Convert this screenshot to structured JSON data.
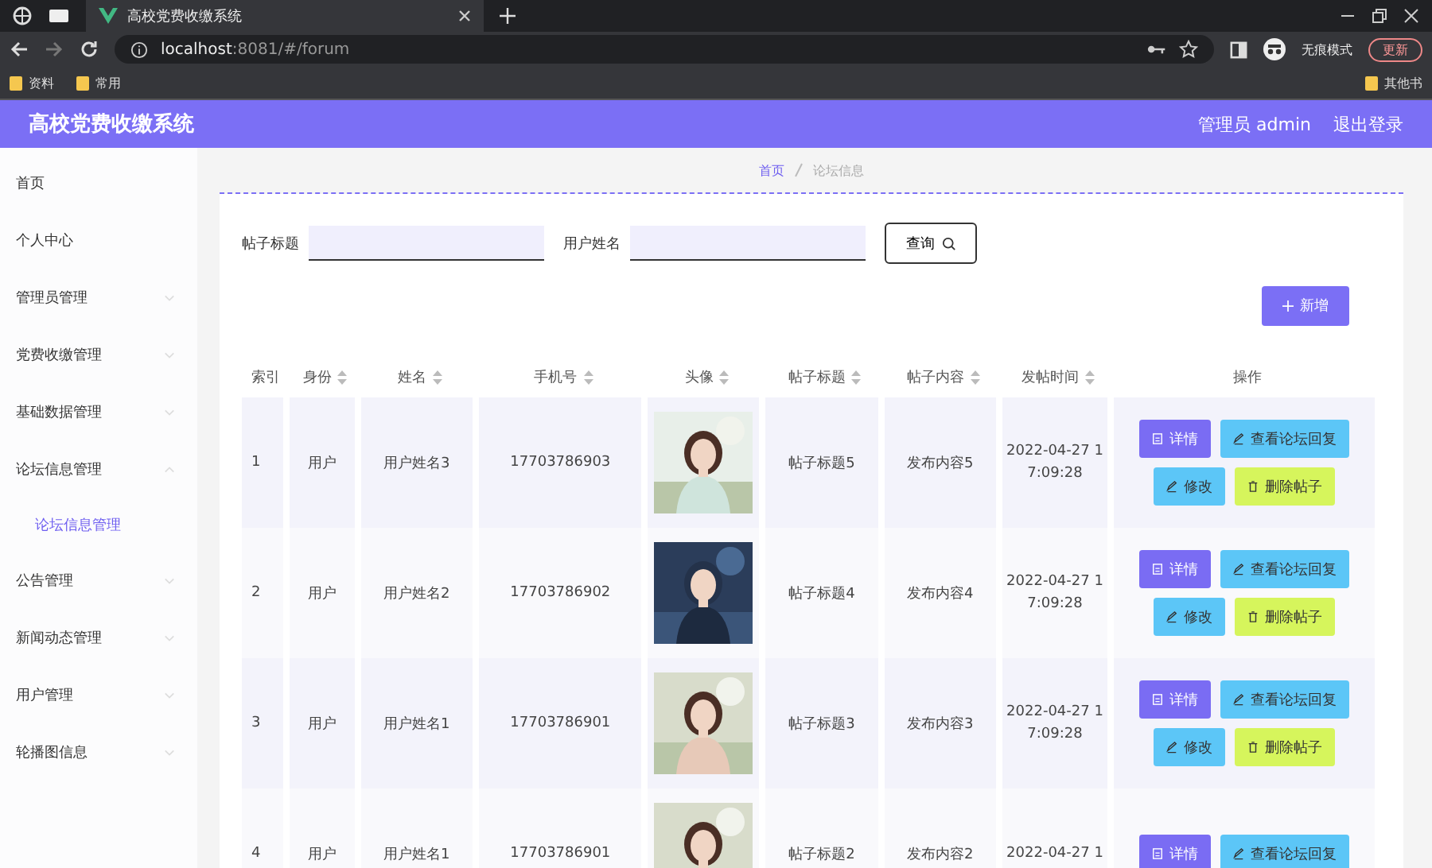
{
  "browser": {
    "tab_title": "高校党费收缴系统",
    "url_host": "localhost",
    "url_rest": ":8081/#/forum",
    "incognito": "无痕模式",
    "update": "更新",
    "bookmarks": [
      "资料",
      "常用"
    ],
    "other_bookmarks": "其他书"
  },
  "header": {
    "title": "高校党费收缴系统",
    "user": "管理员 admin",
    "logout": "退出登录"
  },
  "sidebar": {
    "items": [
      {
        "label": "首页",
        "has_children": false
      },
      {
        "label": "个人中心",
        "has_children": false
      },
      {
        "label": "管理员管理",
        "expanded": false,
        "has_children": true
      },
      {
        "label": "党费收缴管理",
        "expanded": false,
        "has_children": true
      },
      {
        "label": "基础数据管理",
        "expanded": false,
        "has_children": true
      },
      {
        "label": "论坛信息管理",
        "expanded": true,
        "has_children": true,
        "children": [
          {
            "label": "论坛信息管理",
            "selected": true
          }
        ]
      },
      {
        "label": "公告管理",
        "expanded": false,
        "has_children": true
      },
      {
        "label": "新闻动态管理",
        "expanded": false,
        "has_children": true
      },
      {
        "label": "用户管理",
        "expanded": false,
        "has_children": true
      },
      {
        "label": "轮播图信息",
        "expanded": false,
        "has_children": true
      }
    ]
  },
  "breadcrumb": [
    "首页",
    "论坛信息"
  ],
  "search": {
    "fields": [
      {
        "label": "帖子标题"
      },
      {
        "label": "用户姓名"
      }
    ],
    "button": "查询"
  },
  "add_button": "新增",
  "table": {
    "columns": [
      {
        "label": "索引",
        "sortable": false
      },
      {
        "label": "身份",
        "sortable": true
      },
      {
        "label": "姓名",
        "sortable": true
      },
      {
        "label": "手机号",
        "sortable": true
      },
      {
        "label": "头像",
        "sortable": true
      },
      {
        "label": "帖子标题",
        "sortable": true
      },
      {
        "label": "帖子内容",
        "sortable": true
      },
      {
        "label": "发帖时间",
        "sortable": true
      },
      {
        "label": "操作",
        "sortable": false
      }
    ],
    "rows": [
      {
        "index": "1",
        "role": "用户",
        "name": "用户姓名3",
        "phone": "17703786903",
        "title": "帖子标题5",
        "content": "发布内容5",
        "time": "2022-04-27 17:09:28",
        "actions": [
          {
            "label": "详情",
            "kind": "detail"
          },
          {
            "label": "查看论坛回复",
            "kind": "reply"
          },
          {
            "label": "修改",
            "kind": "edit"
          },
          {
            "label": "删除帖子",
            "kind": "delete"
          }
        ]
      },
      {
        "index": "2",
        "role": "用户",
        "name": "用户姓名2",
        "phone": "17703786902",
        "title": "帖子标题4",
        "content": "发布内容4",
        "time": "2022-04-27 17:09:28",
        "actions": [
          {
            "label": "详情",
            "kind": "detail"
          },
          {
            "label": "查看论坛回复",
            "kind": "reply"
          },
          {
            "label": "修改",
            "kind": "edit"
          },
          {
            "label": "删除帖子",
            "kind": "delete"
          }
        ]
      },
      {
        "index": "3",
        "role": "用户",
        "name": "用户姓名1",
        "phone": "17703786901",
        "title": "帖子标题3",
        "content": "发布内容3",
        "time": "2022-04-27 17:09:28",
        "actions": [
          {
            "label": "详情",
            "kind": "detail"
          },
          {
            "label": "查看论坛回复",
            "kind": "reply"
          },
          {
            "label": "修改",
            "kind": "edit"
          },
          {
            "label": "删除帖子",
            "kind": "delete"
          }
        ]
      },
      {
        "index": "4",
        "role": "用户",
        "name": "用户姓名1",
        "phone": "17703786901",
        "title": "帖子标题2",
        "content": "发布内容2",
        "time": "2022-04-27 1",
        "actions": [
          {
            "label": "详情",
            "kind": "detail"
          },
          {
            "label": "查看论坛回复",
            "kind": "reply"
          }
        ]
      }
    ]
  }
}
